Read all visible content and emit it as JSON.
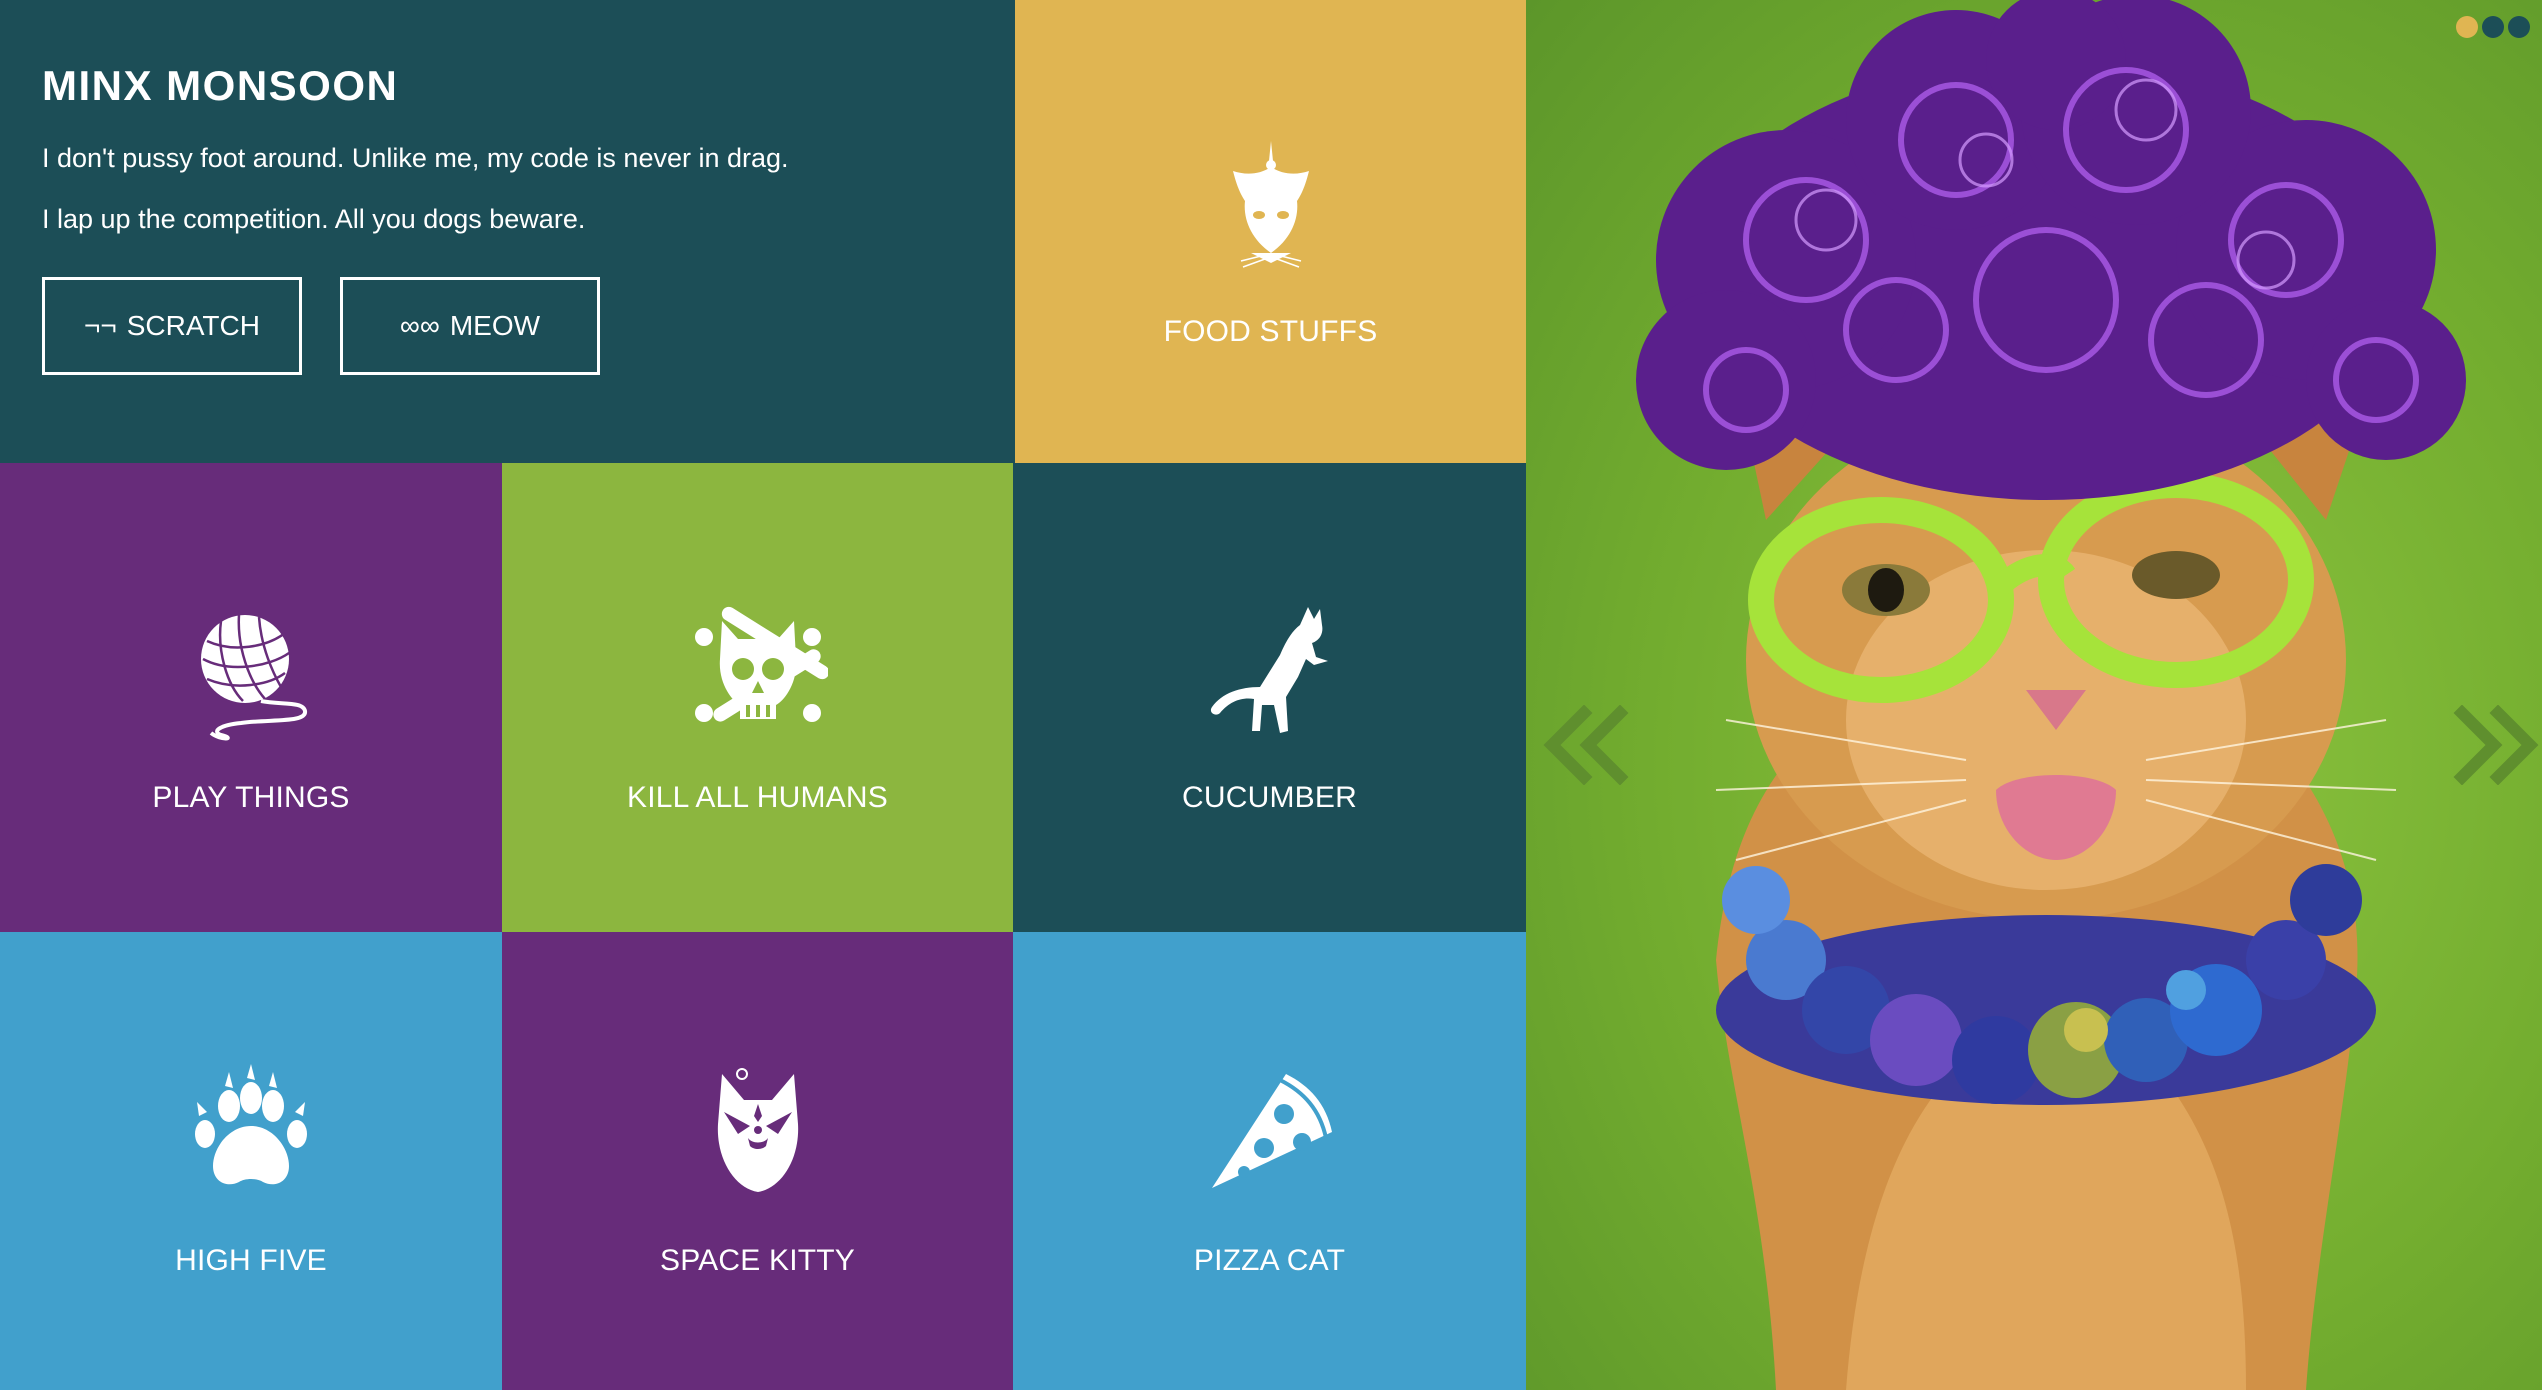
{
  "intro": {
    "title": "MINX MONSOON",
    "lines": [
      "I don't pussy foot around. Unlike me, my code is never in drag.",
      "I lap up the competition. All you dogs beware."
    ],
    "buttons": [
      {
        "glyph": "¬¬",
        "label": "SCRATCH"
      },
      {
        "glyph": "∞∞",
        "label": "MEOW"
      }
    ]
  },
  "tiles": [
    {
      "label": "FOOD STUFFS",
      "icon": "cat-fish-icon",
      "color": "#e0b552"
    },
    {
      "label": "PLAY THINGS",
      "icon": "yarn-ball-icon",
      "color": "#672c7a"
    },
    {
      "label": "KILL ALL HUMANS",
      "icon": "cat-skull-icon",
      "color": "#8cb63f"
    },
    {
      "label": "CUCUMBER",
      "icon": "leaping-cat-icon",
      "color": "#1c4e57"
    },
    {
      "label": "HIGH FIVE",
      "icon": "paw-icon",
      "color": "#41a0cc"
    },
    {
      "label": "SPACE KITTY",
      "icon": "space-cat-icon",
      "color": "#672c7a"
    },
    {
      "label": "PIZZA CAT",
      "icon": "pizza-slice-icon",
      "color": "#41a0cc"
    }
  ],
  "hero": {
    "image": "cat-in-purple-wig-photo",
    "prev_icon": "chevron-double-left-icon",
    "next_icon": "chevron-double-right-icon",
    "dots": [
      {
        "color": "#e0b552",
        "active": true
      },
      {
        "color": "#1c4e57",
        "active": false
      },
      {
        "color": "#1c4e57",
        "active": false
      }
    ]
  },
  "colors": {
    "teal": "#1c4e57",
    "mustard": "#e0b552",
    "purple": "#672c7a",
    "green": "#8cb63f",
    "blue": "#41a0cc"
  }
}
